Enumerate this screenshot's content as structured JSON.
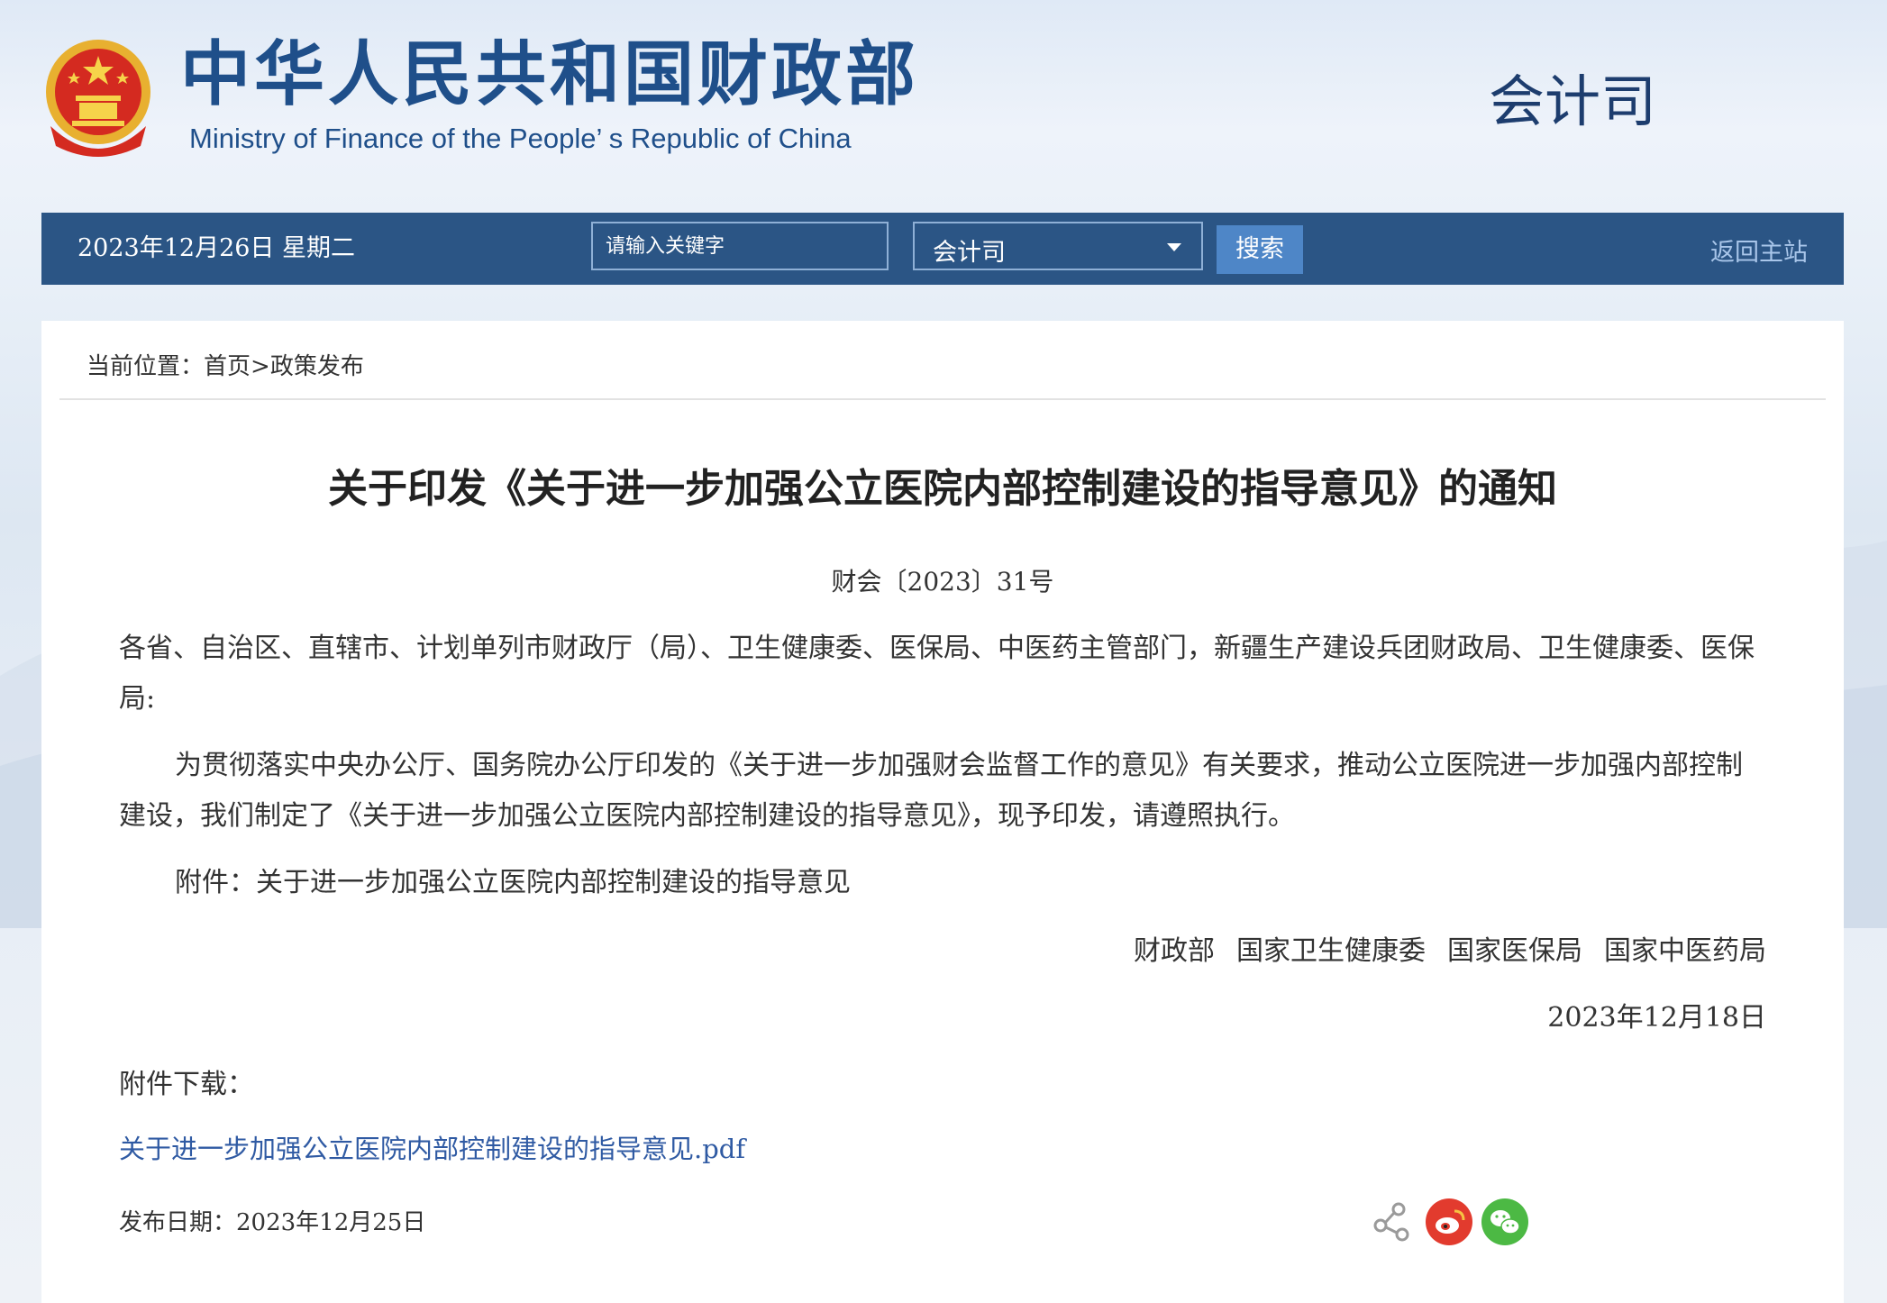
{
  "header": {
    "cn_title": "中华人民共和国财政部",
    "en_title": "Ministry of Finance of the People’ s Republic of China",
    "dept_title": "会计司"
  },
  "navbar": {
    "date": "2023年12月26日  星期二",
    "search_placeholder": "请输入关键字",
    "dept_select_value": "会计司",
    "search_button": "搜索",
    "home_link": "返回主站"
  },
  "breadcrumb": {
    "prefix": "当前位置：",
    "home": "首页",
    "separator": ">",
    "current": "政策发布"
  },
  "article": {
    "title": "关于印发《关于进一步加强公立医院内部控制建设的指导意见》的通知",
    "doc_no": "财会〔2023〕31号",
    "addressees": "各省、自治区、直辖市、计划单列市财政厅（局）、卫生健康委、医保局、中医药主管部门，新疆生产建设兵团财政局、卫生健康委、医保局:",
    "body": "为贯彻落实中央办公厅、国务院办公厅印发的《关于进一步加强财会监督工作的意见》有关要求，推动公立医院进一步加强内部控制建设，我们制定了《关于进一步加强公立医院内部控制建设的指导意见》，现予印发，请遵照执行。",
    "attachment_line": "附件：关于进一步加强公立医院内部控制建设的指导意见",
    "signers": [
      "财政部",
      "国家卫生健康委",
      "国家医保局",
      "国家中医药局"
    ],
    "sign_date": "2023年12月18日",
    "attachment_label": "附件下载：",
    "attachment_file": "关于进一步加强公立医院内部控制建设的指导意见.pdf",
    "publish_date": "发布日期：2023年12月25日"
  },
  "share": {
    "icons": [
      "share-icon",
      "weibo-icon",
      "wechat-icon"
    ],
    "colors": {
      "weibo": "#e23b2e",
      "wechat": "#4cb944"
    }
  },
  "colors": {
    "brand_blue": "#1f4f8a",
    "navbar": "#2b5585",
    "search_button": "#4e86c7",
    "link": "#2f5aa3"
  }
}
